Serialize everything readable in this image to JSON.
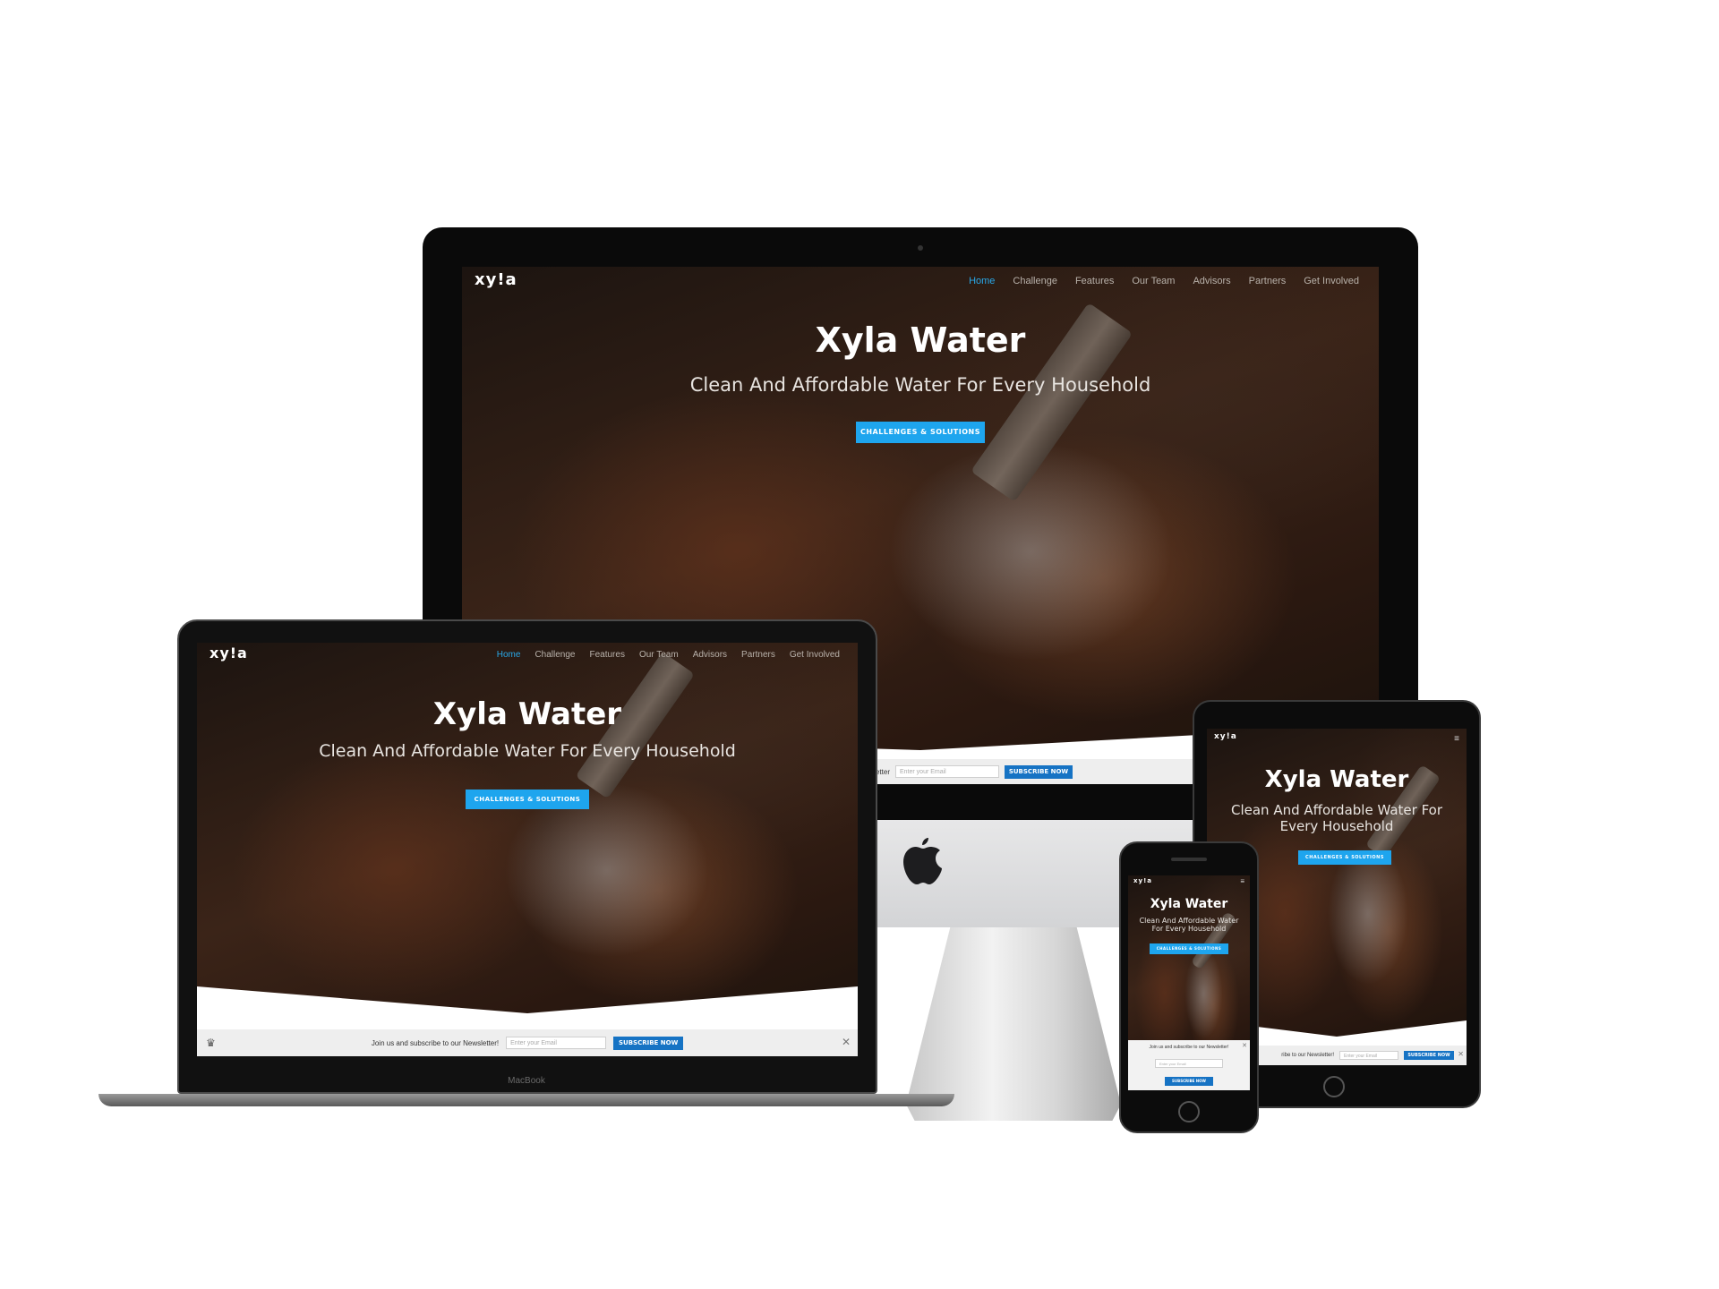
{
  "site": {
    "logo": "xy!a",
    "title": "Xyla Water",
    "subtitle": "Clean And Affordable Water For Every Household",
    "cta": "Challenges & Solutions",
    "nav": [
      "Home",
      "Challenge",
      "Features",
      "Our Team",
      "Advisors",
      "Partners",
      "Get Involved"
    ],
    "newsletter": {
      "text": "Join us and subscribe to our Newsletter!",
      "placeholder": "Enter your Email",
      "button": "Subscribe Now"
    }
  },
  "devices": {
    "laptop_brand": "MacBook"
  },
  "colors": {
    "accent": "#1ea5ee",
    "nav_active": "#29a8e8",
    "subscribe": "#1673c4"
  }
}
